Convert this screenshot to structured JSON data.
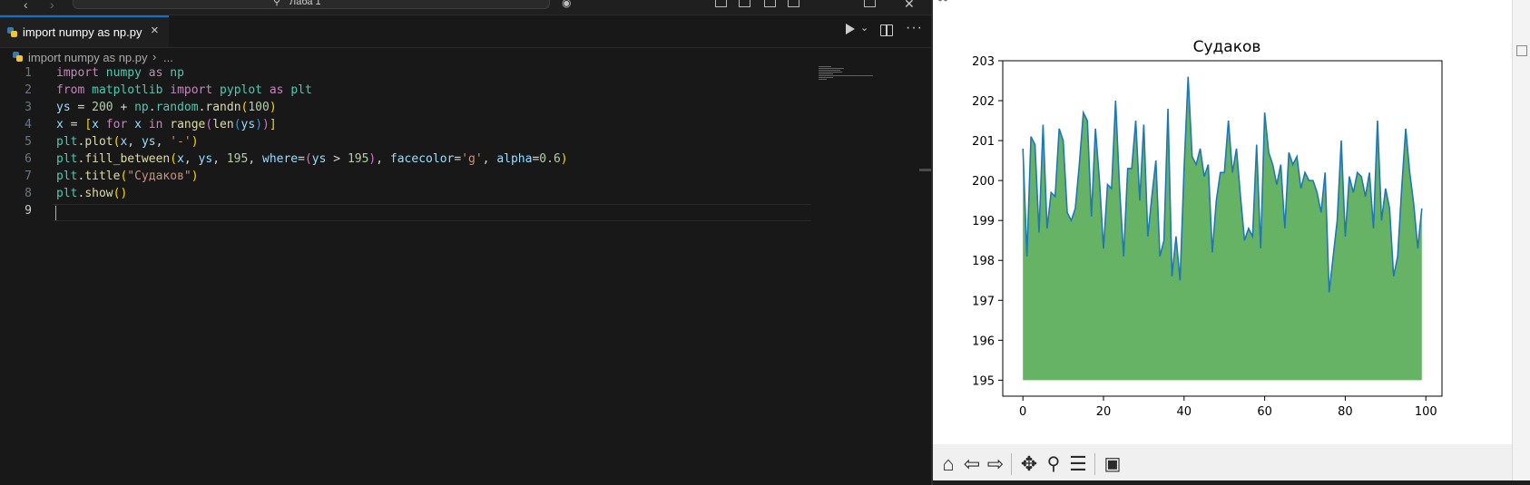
{
  "titlebar": {
    "search_text": "Лаба 1"
  },
  "tab": {
    "label": "import numpy as np.py",
    "close": "×"
  },
  "editor_actions": {
    "more": "···"
  },
  "breadcrumb": {
    "file": "import numpy as np.py",
    "separator": "›",
    "ellipsis": "..."
  },
  "code": {
    "line_numbers": [
      "1",
      "2",
      "3",
      "4",
      "5",
      "6",
      "7",
      "8",
      "9"
    ],
    "lines": [
      "import numpy as np",
      "from matplotlib import pyplot as plt",
      "ys = 200 + np.random.randn(100)",
      "x = [x for x in range(len(ys))]",
      "plt.plot(x, ys, '-')",
      "plt.fill_between(x, ys, 195, where=(ys > 195), facecolor='g', alpha=0.6)",
      "plt.title(\"Судаков\")",
      "plt.show()",
      ""
    ],
    "active_line": 9
  },
  "colors": {
    "editor_bg": "#181818",
    "line_color": "#1f77b4",
    "fill_color": "#008000",
    "fill_alpha": 0.6,
    "accent": "#0078d4"
  },
  "figure": {
    "toolbar_icons": [
      "home-icon",
      "back-icon",
      "forward-icon",
      "pan-icon",
      "zoom-icon",
      "configure-icon",
      "save-icon"
    ]
  },
  "chart_data": {
    "type": "area",
    "title": "Судаков",
    "xlabel": "",
    "ylabel": "",
    "xlim": [
      -5,
      104
    ],
    "ylim": [
      194.6,
      203.0
    ],
    "xticks": [
      0,
      20,
      40,
      60,
      80,
      100
    ],
    "yticks": [
      195,
      196,
      197,
      198,
      199,
      200,
      201,
      202,
      203
    ],
    "fill_baseline": 195,
    "grid": false,
    "series": [
      {
        "x": [
          0,
          1,
          2,
          3,
          4,
          5,
          6,
          7,
          8,
          9,
          10,
          11,
          12,
          13,
          14,
          15,
          16,
          17,
          18,
          19,
          20,
          21,
          22,
          23,
          24,
          25,
          26,
          27,
          28,
          29,
          30,
          31,
          32,
          33,
          34,
          35,
          36,
          37,
          38,
          39,
          40,
          41,
          42,
          43,
          44,
          45,
          46,
          47,
          48,
          49,
          50,
          51,
          52,
          53,
          54,
          55,
          56,
          57,
          58,
          59,
          60,
          61,
          62,
          63,
          64,
          65,
          66,
          67,
          68,
          69,
          70,
          71,
          72,
          73,
          74,
          75,
          76,
          77,
          78,
          79,
          80,
          81,
          82,
          83,
          84,
          85,
          86,
          87,
          88,
          89,
          90,
          91,
          92,
          93,
          94,
          95,
          96,
          97,
          98,
          99
        ],
        "values": [
          200.8,
          198.1,
          201.1,
          200.9,
          198.7,
          201.4,
          198.8,
          199.7,
          199.6,
          201.3,
          201.0,
          199.2,
          199.0,
          199.3,
          200.4,
          201.7,
          201.5,
          199.1,
          201.3,
          200.0,
          198.3,
          199.9,
          199.8,
          202.0,
          199.8,
          198.1,
          200.3,
          200.3,
          201.5,
          199.5,
          201.4,
          198.6,
          199.6,
          200.5,
          198.1,
          198.5,
          201.8,
          197.6,
          198.6,
          197.5,
          200.3,
          202.6,
          200.6,
          200.4,
          200.8,
          200.1,
          200.4,
          198.2,
          199.5,
          200.2,
          200.2,
          201.5,
          200.2,
          200.8,
          199.6,
          198.5,
          198.8,
          198.6,
          200.9,
          198.3,
          201.7,
          200.7,
          200.4,
          199.9,
          200.4,
          198.8,
          200.7,
          200.4,
          200.6,
          199.8,
          200.2,
          200.0,
          200.0,
          199.7,
          199.2,
          200.2,
          197.2,
          198.1,
          199.0,
          201.0,
          198.6,
          200.1,
          199.7,
          200.2,
          200.1,
          199.6,
          200.2,
          198.8,
          201.5,
          199.0,
          199.8,
          199.3,
          197.6,
          198.1,
          199.8,
          201.3,
          200.2,
          199.4,
          198.3,
          199.3
        ]
      }
    ]
  }
}
